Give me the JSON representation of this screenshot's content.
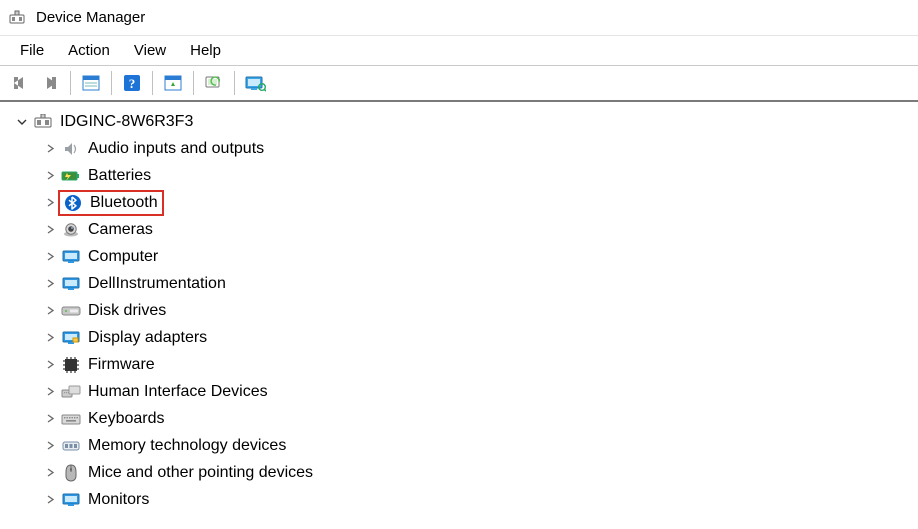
{
  "window": {
    "title": "Device Manager"
  },
  "menu": {
    "items": [
      "File",
      "Action",
      "View",
      "Help"
    ]
  },
  "toolbar": {
    "buttons": [
      "back",
      "forward",
      "properties",
      "help",
      "update",
      "scan",
      "show-hidden"
    ]
  },
  "tree": {
    "root": {
      "label": "IDGINC-8W6R3F3",
      "expanded": true
    },
    "children": [
      {
        "icon": "audio",
        "label": "Audio inputs and outputs",
        "highlight": false
      },
      {
        "icon": "battery",
        "label": "Batteries",
        "highlight": false
      },
      {
        "icon": "bluetooth",
        "label": "Bluetooth",
        "highlight": true
      },
      {
        "icon": "camera",
        "label": "Cameras",
        "highlight": false
      },
      {
        "icon": "computer",
        "label": "Computer",
        "highlight": false
      },
      {
        "icon": "computer",
        "label": "DellInstrumentation",
        "highlight": false
      },
      {
        "icon": "disk",
        "label": "Disk drives",
        "highlight": false
      },
      {
        "icon": "display",
        "label": "Display adapters",
        "highlight": false
      },
      {
        "icon": "firmware",
        "label": "Firmware",
        "highlight": false
      },
      {
        "icon": "hid",
        "label": "Human Interface Devices",
        "highlight": false
      },
      {
        "icon": "keyboard",
        "label": "Keyboards",
        "highlight": false
      },
      {
        "icon": "memory",
        "label": "Memory technology devices",
        "highlight": false
      },
      {
        "icon": "mouse",
        "label": "Mice and other pointing devices",
        "highlight": false
      },
      {
        "icon": "monitor",
        "label": "Monitors",
        "highlight": false
      }
    ]
  }
}
